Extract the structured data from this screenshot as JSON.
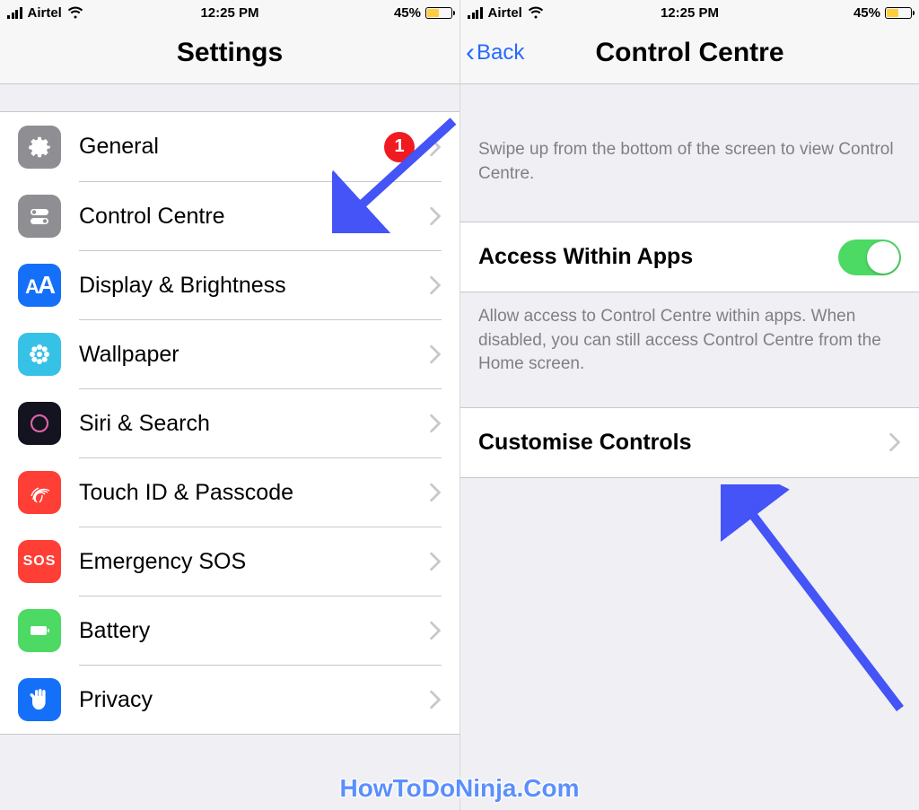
{
  "status": {
    "carrier": "Airtel",
    "time": "12:25 PM",
    "battery_pct": "45%"
  },
  "left": {
    "title": "Settings",
    "items": [
      {
        "label": "General",
        "icon": "gear-icon",
        "badge": "1"
      },
      {
        "label": "Control Centre",
        "icon": "toggles-icon"
      },
      {
        "label": "Display & Brightness",
        "icon": "letters-icon"
      },
      {
        "label": "Wallpaper",
        "icon": "flower-icon"
      },
      {
        "label": "Siri & Search",
        "icon": "siri-icon"
      },
      {
        "label": "Touch ID & Passcode",
        "icon": "fingerprint-icon"
      },
      {
        "label": "Emergency SOS",
        "icon": "sos-icon"
      },
      {
        "label": "Battery",
        "icon": "battery-icon"
      },
      {
        "label": "Privacy",
        "icon": "hand-icon"
      }
    ]
  },
  "right": {
    "back": "Back",
    "title": "Control Centre",
    "hint_top": "Swipe up from the bottom of the screen to view Control Centre.",
    "access_label": "Access Within Apps",
    "access_hint": "Allow access to Control Centre within apps. When disabled, you can still access Control Centre from the Home screen.",
    "customise_label": "Customise Controls"
  },
  "watermark": "HowToDoNinja.Com"
}
